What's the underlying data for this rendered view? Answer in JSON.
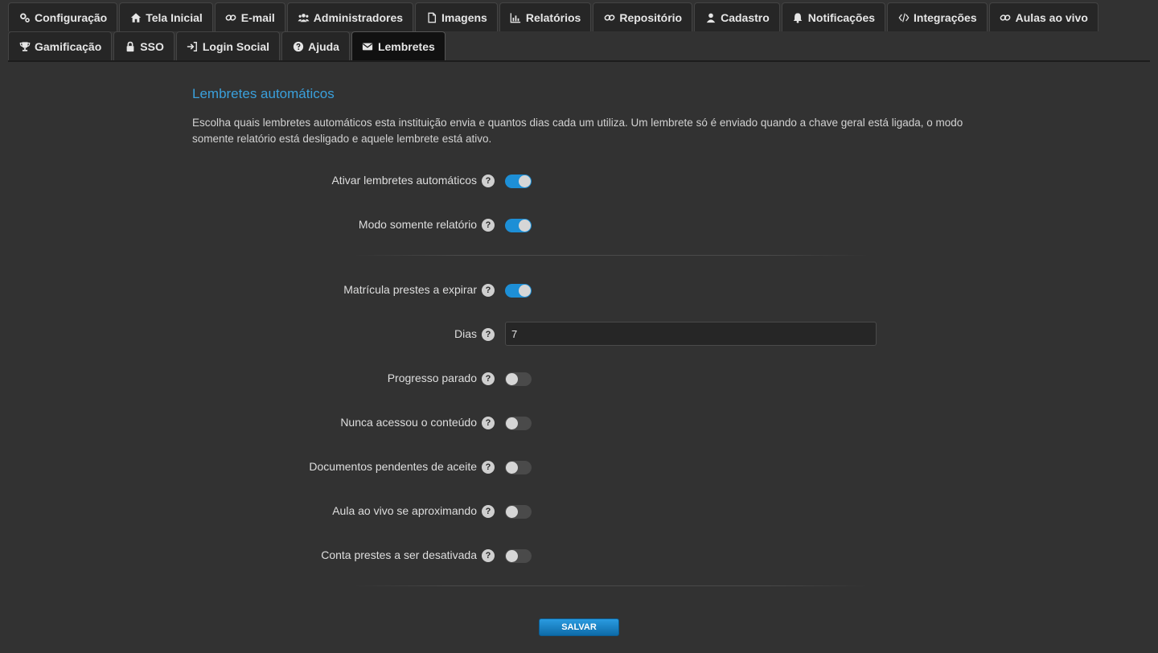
{
  "tabs_row1": [
    {
      "label": "Configuração",
      "icon": "cogs-icon"
    },
    {
      "label": "Tela Inicial",
      "icon": "home-icon"
    },
    {
      "label": "E-mail",
      "icon": "link-icon"
    },
    {
      "label": "Administradores",
      "icon": "users-icon"
    },
    {
      "label": "Imagens",
      "icon": "file-icon"
    },
    {
      "label": "Relatórios",
      "icon": "bar-chart-icon"
    },
    {
      "label": "Repositório",
      "icon": "link-icon"
    },
    {
      "label": "Cadastro",
      "icon": "user-icon"
    },
    {
      "label": "Notificações",
      "icon": "bell-icon"
    },
    {
      "label": "Integrações",
      "icon": "code-icon"
    },
    {
      "label": "Aulas ao vivo",
      "icon": "link-icon"
    }
  ],
  "tabs_row2": [
    {
      "label": "Gamificação",
      "icon": "trophy-icon"
    },
    {
      "label": "SSO",
      "icon": "lock-icon"
    },
    {
      "label": "Login Social",
      "icon": "sign-in-icon"
    },
    {
      "label": "Ajuda",
      "icon": "question-circle-icon"
    },
    {
      "label": "Lembretes",
      "icon": "envelope-icon",
      "active": true
    }
  ],
  "section": {
    "title": "Lembretes automáticos",
    "description": "Escolha quais lembretes automáticos esta instituição envia e quantos dias cada um utiliza. Um lembrete só é enviado quando a chave geral está ligada, o modo somente relatório está desligado e aquele lembrete está ativo."
  },
  "help_glyph": "?",
  "settings": {
    "enable": {
      "label": "Ativar lembretes automáticos",
      "on": true
    },
    "report_only": {
      "label": "Modo somente relatório",
      "on": true
    },
    "expiring": {
      "label": "Matrícula prestes a expirar",
      "on": true
    },
    "days": {
      "label": "Dias",
      "value": "7"
    },
    "stalled": {
      "label": "Progresso parado",
      "on": false
    },
    "never_accessed": {
      "label": "Nunca acessou o conteúdo",
      "on": false
    },
    "pending_docs": {
      "label": "Documentos pendentes de aceite",
      "on": false
    },
    "live_class": {
      "label": "Aula ao vivo se aproximando",
      "on": false
    },
    "deactivation": {
      "label": "Conta prestes a ser desativada",
      "on": false
    }
  },
  "save_label": "SALVAR",
  "colors": {
    "accent": "#1d8fd6",
    "title": "#3aa0dc",
    "background": "#323232"
  }
}
